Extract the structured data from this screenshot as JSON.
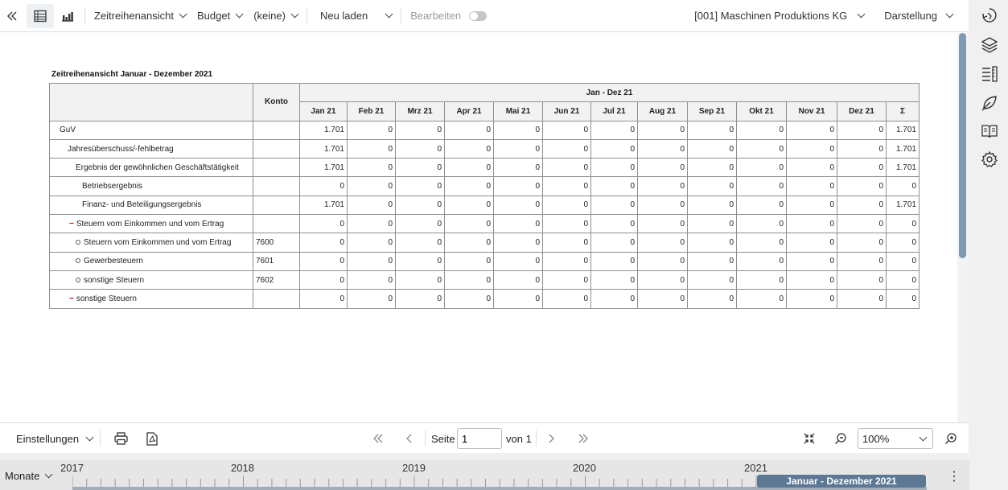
{
  "toolbar": {
    "view_label": "Zeitreihenansicht",
    "scenario_label": "Budget",
    "compare_label": "(keine)",
    "reload_label": "Neu laden",
    "edit_label": "Bearbeiten",
    "company_label": "[001] Maschinen Produktions KG",
    "display_label": "Darstellung"
  },
  "report": {
    "title": "Zeitreihenansicht Januar - Dezember 2021",
    "konto_header": "Konto",
    "period_header": "Jan - Dez 21",
    "months": [
      "Jan 21",
      "Feb 21",
      "Mrz 21",
      "Apr 21",
      "Mai 21",
      "Jun 21",
      "Jul 21",
      "Aug 21",
      "Sep 21",
      "Okt 21",
      "Nov 21",
      "Dez 21"
    ],
    "sum_header": "Σ",
    "rows": [
      {
        "label": "GuV",
        "marker": "",
        "indent": 0,
        "konto": "",
        "values": [
          "1.701",
          "0",
          "0",
          "0",
          "0",
          "0",
          "0",
          "0",
          "0",
          "0",
          "0",
          "0"
        ],
        "sum": "1.701"
      },
      {
        "label": "Jahresüberschuss/-fehlbetrag",
        "marker": "",
        "indent": 1,
        "konto": "",
        "values": [
          "1.701",
          "0",
          "0",
          "0",
          "0",
          "0",
          "0",
          "0",
          "0",
          "0",
          "0",
          "0"
        ],
        "sum": "1.701"
      },
      {
        "label": "Ergebnis der gewöhnlichen Geschäftstätigkeit",
        "marker": "",
        "indent": 2,
        "konto": "",
        "values": [
          "1.701",
          "0",
          "0",
          "0",
          "0",
          "0",
          "0",
          "0",
          "0",
          "0",
          "0",
          "0"
        ],
        "sum": "1.701"
      },
      {
        "label": "Betriebsergebnis",
        "marker": "",
        "indent": 3,
        "konto": "",
        "values": [
          "0",
          "0",
          "0",
          "0",
          "0",
          "0",
          "0",
          "0",
          "0",
          "0",
          "0",
          "0"
        ],
        "sum": "0"
      },
      {
        "label": "Finanz- und Beteiligungsergebnis",
        "marker": "",
        "indent": 3,
        "konto": "",
        "values": [
          "1.701",
          "0",
          "0",
          "0",
          "0",
          "0",
          "0",
          "0",
          "0",
          "0",
          "0",
          "0"
        ],
        "sum": "1.701"
      },
      {
        "label": "Steuern vom Einkommen und vom Ertrag",
        "marker": "minus",
        "indent": 2,
        "konto": "",
        "values": [
          "0",
          "0",
          "0",
          "0",
          "0",
          "0",
          "0",
          "0",
          "0",
          "0",
          "0",
          "0"
        ],
        "sum": "0"
      },
      {
        "label": "Steuern vom Einkommen und vom Ertrag",
        "marker": "circle",
        "indent": 2,
        "konto": "7600",
        "values": [
          "0",
          "0",
          "0",
          "0",
          "0",
          "0",
          "0",
          "0",
          "0",
          "0",
          "0",
          "0"
        ],
        "sum": "0"
      },
      {
        "label": "Gewerbesteuern",
        "marker": "circle",
        "indent": 2,
        "konto": "7601",
        "values": [
          "0",
          "0",
          "0",
          "0",
          "0",
          "0",
          "0",
          "0",
          "0",
          "0",
          "0",
          "0"
        ],
        "sum": "0"
      },
      {
        "label": "sonstige Steuern",
        "marker": "circle",
        "indent": 2,
        "konto": "7602",
        "values": [
          "0",
          "0",
          "0",
          "0",
          "0",
          "0",
          "0",
          "0",
          "0",
          "0",
          "0",
          "0"
        ],
        "sum": "0"
      },
      {
        "label": "sonstige Steuern",
        "marker": "minus",
        "indent": 2,
        "konto": "",
        "values": [
          "0",
          "0",
          "0",
          "0",
          "0",
          "0",
          "0",
          "0",
          "0",
          "0",
          "0",
          "0"
        ],
        "sum": "0"
      }
    ]
  },
  "footer": {
    "settings_label": "Einstellungen",
    "page_label": "Seite",
    "page_value": "1",
    "of_label": "von 1",
    "zoom_value": "100%"
  },
  "timeline": {
    "unit_label": "Monate",
    "years": [
      "2017",
      "2018",
      "2019",
      "2020",
      "2021"
    ],
    "range_label": "Januar - Dezember 2021"
  },
  "colors": {
    "accent": "#5d7895",
    "scroll_thumb": "#7f9ab3",
    "minus_marker": "#dd0000"
  }
}
